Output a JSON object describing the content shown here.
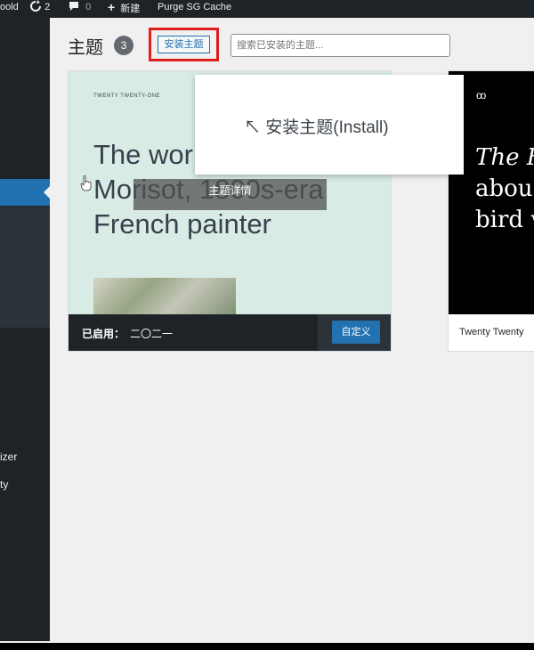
{
  "adminbar": {
    "site": "oold",
    "updates": "2",
    "comments": "0",
    "new": "新建",
    "purge": "Purge SG Cache"
  },
  "sidebar": {
    "customizer": "izer",
    "privacy": "ty"
  },
  "header": {
    "title": "主题",
    "count": "3",
    "install_button": "安装主题",
    "search_placeholder": "搜索已安装的主题..."
  },
  "theme1": {
    "brand": "TWENTY TWENTY-ONE",
    "headline": "The work of Berthe Morisot, 1800s-era French painter",
    "details": "主题详情",
    "active_label": "已启用：",
    "active_name": "二〇二一",
    "customize": "自定义"
  },
  "theme2": {
    "logo": "oo",
    "headline_1": "The H",
    "headline_2": "abou",
    "headline_3": "bird w",
    "name": "Twenty Twenty"
  },
  "tooltip": {
    "text": "↖ 安装主题(Install)"
  },
  "colors": {
    "admin_dark": "#1d2327",
    "accent": "#2271b1",
    "highlight_border": "#e01e1e",
    "theme1_bg": "#d9ebe5"
  }
}
